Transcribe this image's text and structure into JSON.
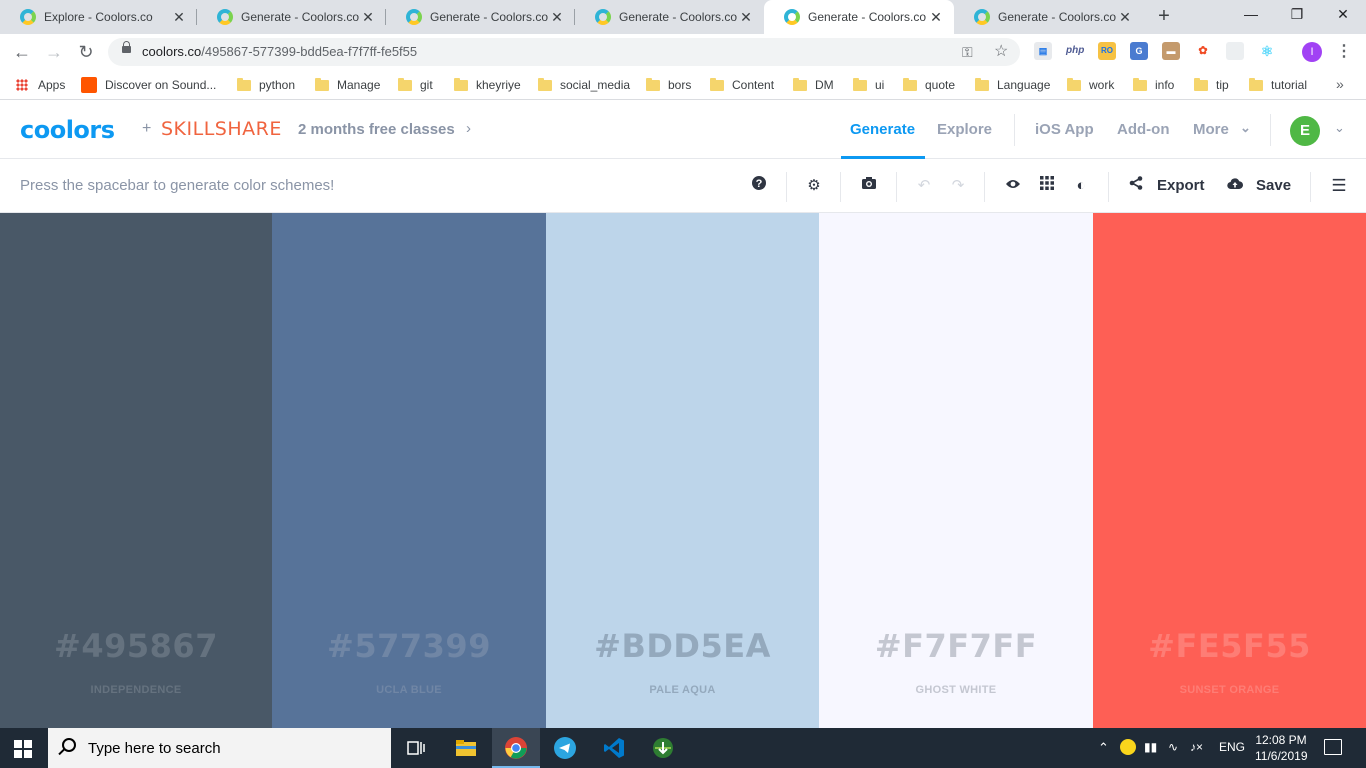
{
  "browser": {
    "tabs": [
      {
        "title": "Explore - Coolors.co",
        "active": false
      },
      {
        "title": "Generate - Coolors.co",
        "active": false
      },
      {
        "title": "Generate - Coolors.co",
        "active": false
      },
      {
        "title": "Generate - Coolors.co",
        "active": false
      },
      {
        "title": "Generate - Coolors.co",
        "active": true
      },
      {
        "title": "Generate - Coolors.co",
        "active": false
      }
    ],
    "close_glyph": "✕",
    "new_tab_glyph": "+",
    "url_host": "coolors.co",
    "url_path": "/495867-577399-bdd5ea-f7f7ff-fe5f55",
    "profile_initial": "I",
    "extensions": {
      "php": "php",
      "ro": "RO"
    },
    "bookmarks": [
      {
        "label": "Apps",
        "icon": "apps-grid-icon"
      },
      {
        "label": "Discover on Sound...",
        "icon": "soundcloud-icon"
      },
      {
        "label": "python",
        "icon": "folder-icon"
      },
      {
        "label": "Manage",
        "icon": "folder-icon"
      },
      {
        "label": "git",
        "icon": "folder-icon"
      },
      {
        "label": "kheyriye",
        "icon": "folder-icon"
      },
      {
        "label": "social_media",
        "icon": "folder-icon"
      },
      {
        "label": "bors",
        "icon": "folder-icon"
      },
      {
        "label": "Content",
        "icon": "folder-icon"
      },
      {
        "label": "DM",
        "icon": "folder-icon"
      },
      {
        "label": "ui",
        "icon": "folder-icon"
      },
      {
        "label": "quote",
        "icon": "folder-icon"
      },
      {
        "label": "Language",
        "icon": "folder-icon"
      },
      {
        "label": "work",
        "icon": "folder-icon"
      },
      {
        "label": "info",
        "icon": "folder-icon"
      },
      {
        "label": "tip",
        "icon": "folder-icon"
      },
      {
        "label": "tutorial",
        "icon": "folder-icon"
      }
    ],
    "bookmarks_more": "»"
  },
  "header": {
    "logo": "coolors",
    "plus": "+",
    "partner": "SKILLSHARE",
    "promo": "2 months free classes",
    "nav": {
      "generate": "Generate",
      "explore": "Explore",
      "ios_app": "iOS App",
      "add_on": "Add-on",
      "more": "More"
    },
    "user_initial": "E",
    "accent_color": "#0d99f2"
  },
  "toolbar": {
    "hint": "Press the spacebar to generate color schemes!",
    "export_label": "Export",
    "save_label": "Save"
  },
  "palette": [
    {
      "hex": "#495867",
      "name": "INDEPENDENCE",
      "color": "#495867",
      "text_color": "#65727f"
    },
    {
      "hex": "#577399",
      "name": "UCLA BLUE",
      "color": "#577399",
      "text_color": "#7086a5"
    },
    {
      "hex": "#BDD5EA",
      "name": "PALE AQUA",
      "color": "#bdd5ea",
      "text_color": "#94a9bd"
    },
    {
      "hex": "#F7F7FF",
      "name": "GHOST WHITE",
      "color": "#f7f7ff",
      "text_color": "#c4c7d1"
    },
    {
      "hex": "#FE5F55",
      "name": "SUNSET ORANGE",
      "color": "#fe5f55",
      "text_color": "#fe7d75"
    }
  ],
  "taskbar": {
    "search_placeholder": "Type here to search",
    "language": "ENG",
    "time": "12:08 PM",
    "date": "11/6/2019"
  }
}
